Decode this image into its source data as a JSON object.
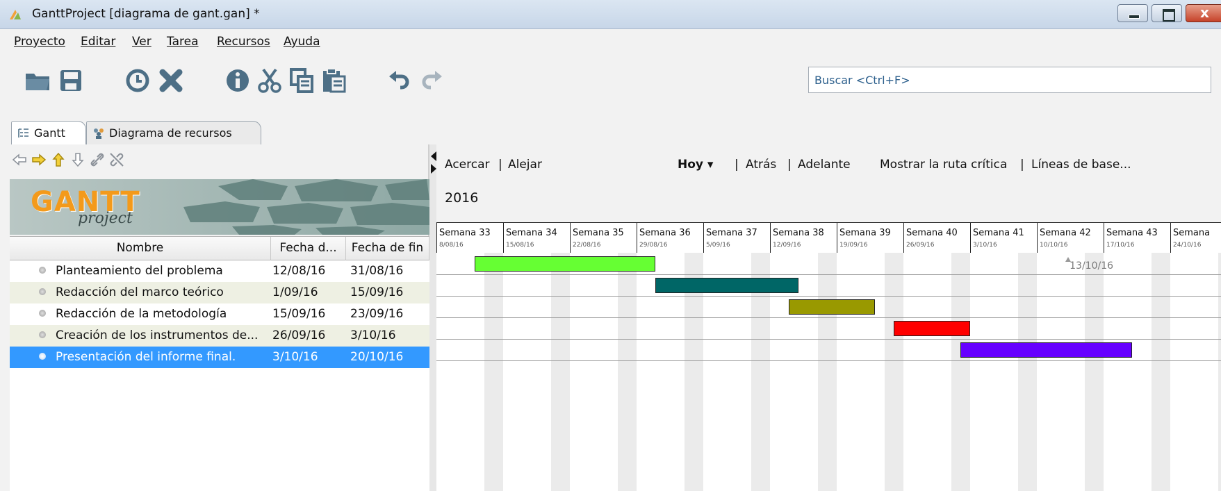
{
  "window": {
    "title": "GanttProject [diagrama de gant.gan] *"
  },
  "menu": [
    {
      "label": "Proyecto"
    },
    {
      "label": "Editar"
    },
    {
      "label": "Ver"
    },
    {
      "label": "Tarea"
    },
    {
      "label": "Recursos"
    },
    {
      "label": "Ayuda"
    }
  ],
  "toolbar": {
    "icons": [
      "open-folder-icon",
      "save-icon",
      "clock-icon",
      "delete-icon",
      "info-icon",
      "cut-icon",
      "copy-icon",
      "paste-icon",
      "undo-icon",
      "redo-icon"
    ],
    "search_placeholder": "Buscar <Ctrl+F>"
  },
  "tabs": [
    {
      "label": "Gantt",
      "icon": "gantt-tree-icon",
      "active": true
    },
    {
      "label": "Diagrama de recursos",
      "icon": "resources-icon",
      "active": false
    }
  ],
  "left_tools": [
    "arrow-left-icon",
    "arrow-right-icon",
    "arrow-up-icon",
    "arrow-down-icon",
    "link-icon",
    "unlink-icon"
  ],
  "logo": {
    "gantt": "GANTT",
    "project": "project"
  },
  "table": {
    "headers": {
      "name": "Nombre",
      "start": "Fecha d...",
      "end": "Fecha de fin"
    },
    "rows": [
      {
        "name": "Planteamiento del problema",
        "start": "12/08/16",
        "end": "31/08/16"
      },
      {
        "name": "Redacción del marco teórico",
        "start": "1/09/16",
        "end": "15/09/16"
      },
      {
        "name": "Redacción de la metodología",
        "start": "15/09/16",
        "end": "23/09/16"
      },
      {
        "name": "Creación de los instrumentos de...",
        "start": "26/09/16",
        "end": "3/10/16"
      },
      {
        "name": "Presentación del informe final.",
        "start": "3/10/16",
        "end": "20/10/16",
        "selected": true
      }
    ]
  },
  "chart_toolbar": {
    "zoom_in": "Acercar",
    "sep1": "|",
    "zoom_out": "Alejar",
    "today": "Hoy",
    "sep2": "|",
    "back": "Atrás",
    "sep3": "|",
    "forward": "Adelante",
    "critical_path": "Mostrar la ruta crítica",
    "sep4": "|",
    "baselines": "Líneas de base...",
    "year": "2016"
  },
  "weeks": [
    {
      "label": "Semana 33",
      "date": "8/08/16"
    },
    {
      "label": "Semana 34",
      "date": "15/08/16"
    },
    {
      "label": "Semana 35",
      "date": "22/08/16"
    },
    {
      "label": "Semana 36",
      "date": "29/08/16"
    },
    {
      "label": "Semana 37",
      "date": "5/09/16"
    },
    {
      "label": "Semana 38",
      "date": "12/09/16"
    },
    {
      "label": "Semana 39",
      "date": "19/09/16"
    },
    {
      "label": "Semana 40",
      "date": "26/09/16"
    },
    {
      "label": "Semana 41",
      "date": "3/10/16"
    },
    {
      "label": "Semana 42",
      "date": "10/10/16"
    },
    {
      "label": "Semana 43",
      "date": "17/10/16"
    },
    {
      "label": "Semana",
      "date": "24/10/16"
    }
  ],
  "today_marker": "13/10/16",
  "chart_data": {
    "type": "gantt",
    "axis_start": "2016-08-08",
    "tasks": [
      {
        "start": "2016-08-12",
        "end": "2016-08-31",
        "color": "#66ff33"
      },
      {
        "start": "2016-08-31",
        "end": "2016-09-15",
        "color": "#006666"
      },
      {
        "start": "2016-09-14",
        "end": "2016-09-23",
        "color": "#999900"
      },
      {
        "start": "2016-09-25",
        "end": "2016-10-03",
        "color": "#ff0000"
      },
      {
        "start": "2016-10-02",
        "end": "2016-10-20",
        "color": "#6600ff"
      }
    ],
    "today": "2016-10-13"
  }
}
